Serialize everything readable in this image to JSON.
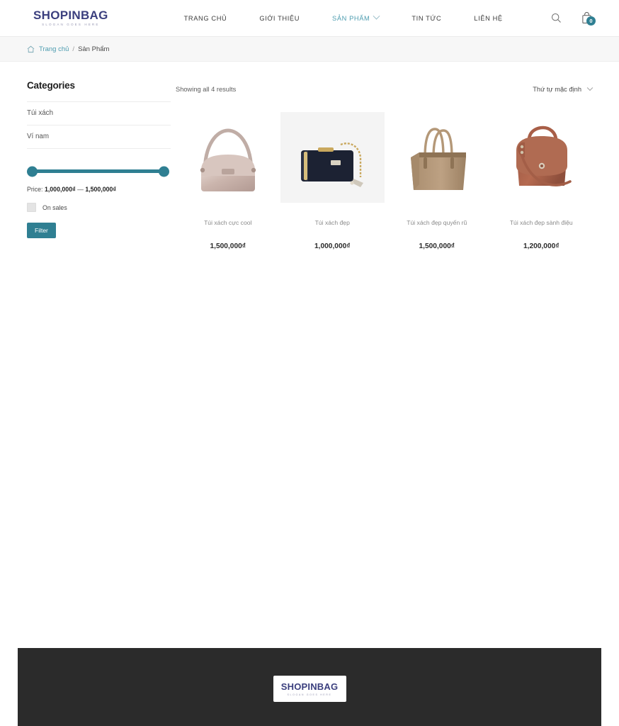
{
  "header": {
    "logo_main": "SHOPINBAG",
    "logo_sub": "SLOGAN GOES HERE",
    "nav": [
      {
        "label": "TRANG CHỦ",
        "active": false
      },
      {
        "label": "GIỚI THIỆU",
        "active": false
      },
      {
        "label": "SẢN PHẨM",
        "active": true
      },
      {
        "label": "TIN TỨC",
        "active": false
      },
      {
        "label": "LIÊN HỆ",
        "active": false
      }
    ],
    "search_icon": "search-icon",
    "cart_icon": "cart-bag-icon",
    "cart_count": "0"
  },
  "breadcrumb": {
    "home_icon": "home-icon",
    "home_label": "Trang chủ",
    "separator": "/",
    "current": "Sản Phẩm"
  },
  "sidebar": {
    "title": "Categories",
    "categories": [
      {
        "label": "Túi xách"
      },
      {
        "label": "Ví nam"
      }
    ],
    "price_filter": {
      "label_prefix": "Price:",
      "min": "1,000,000₫",
      "dash": "—",
      "max": "1,500,000₫"
    },
    "on_sales_label": "On sales",
    "on_sales_checked": false,
    "filter_button": "Filter"
  },
  "toolbar": {
    "results_text": "Showing all 4 results",
    "sort_value": "Thứ tự mặc định"
  },
  "products": [
    {
      "title": "Túi xách cực cool",
      "price": "1,500,000₫",
      "image_alt": "rose-metallic-shoulder-bag",
      "tinted": false
    },
    {
      "title": "Túi xách đẹp",
      "price": "1,000,000₫",
      "image_alt": "navy-box-clutch-gold-chain",
      "tinted": true
    },
    {
      "title": "Túi xách đẹp quyến rũ",
      "price": "1,500,000₫",
      "image_alt": "tan-leather-tote-bag",
      "tinted": false
    },
    {
      "title": "Túi xách đẹp sành điệu",
      "price": "1,200,000₫",
      "image_alt": "brown-leather-satchel",
      "tinted": false
    }
  ],
  "footer": {
    "logo_main": "SHOPINBAG",
    "logo_sub": "SLOGAN GOES HERE",
    "bottom_text": ""
  },
  "colors": {
    "accent_teal": "#2f7f92",
    "link_teal": "#4e9db0",
    "logo_navy": "#3b3f7e",
    "footer_dark": "#2b2b2b"
  }
}
